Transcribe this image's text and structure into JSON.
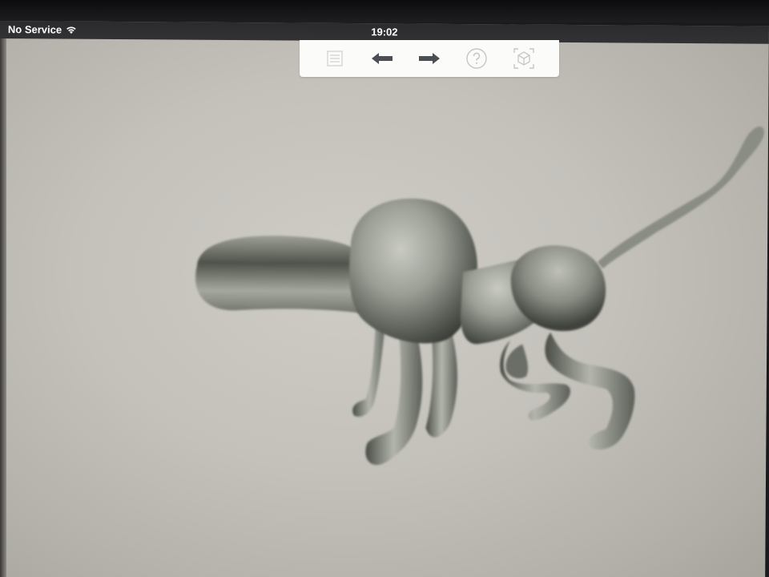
{
  "status_bar": {
    "carrier": "No Service",
    "time": "19:02",
    "wifi_icon": "wifi-icon"
  },
  "toolbar": {
    "buttons": [
      {
        "icon": "list-icon"
      },
      {
        "icon": "undo-arrow-icon"
      },
      {
        "icon": "redo-arrow-icon"
      },
      {
        "icon": "help-icon"
      },
      {
        "icon": "3d-view-icon"
      }
    ]
  },
  "viewport": {
    "model": "3d-creature-model",
    "model_color": "#8f938a",
    "background_color": "#c8c5bf"
  }
}
